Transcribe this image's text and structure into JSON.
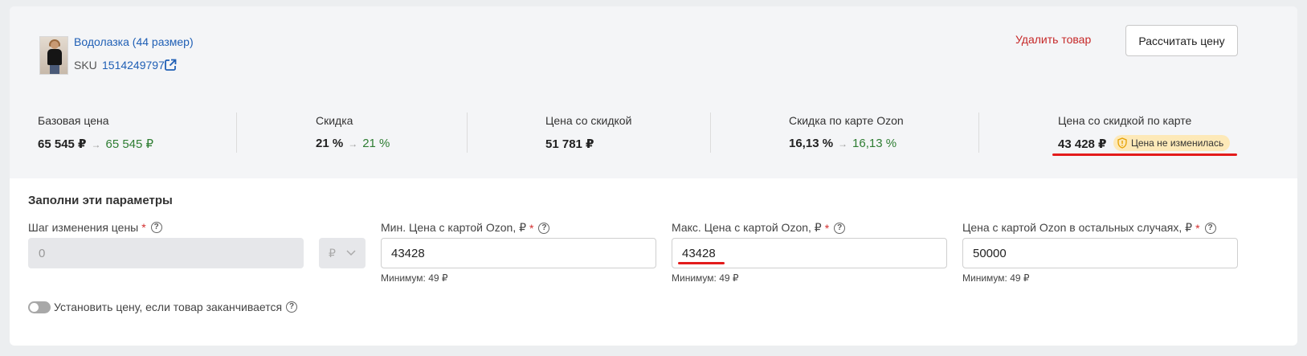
{
  "product": {
    "title": "Водолазка (44 размер)",
    "sku_label": "SKU",
    "sku_value": "1514249797"
  },
  "actions": {
    "delete_label": "Удалить товар",
    "calc_label": "Рассчитать цену"
  },
  "metrics": [
    {
      "label": "Базовая цена",
      "value": "65 545 ₽",
      "new_value": "65 545 ₽"
    },
    {
      "label": "Скидка",
      "value": "21 %",
      "new_value": "21 %"
    },
    {
      "label": "Цена со скидкой",
      "value": "51 781 ₽"
    },
    {
      "label": "Скидка по карте Ozon",
      "value": "16,13 %",
      "new_value": "16,13 %"
    },
    {
      "label": "Цена со скидкой по карте",
      "value": "43 428 ₽",
      "badge": "Цена не изменилась"
    }
  ],
  "form": {
    "title": "Заполни эти параметры",
    "step": {
      "label": "Шаг изменения цены",
      "value": "0",
      "currency": "₽"
    },
    "min_price": {
      "label": "Мин. Цена с картой Ozon, ₽",
      "value": "43428",
      "hint": "Минимум: 49 ₽"
    },
    "max_price": {
      "label": "Макс. Цена с картой Ozon, ₽",
      "value": "43428",
      "hint": "Минимум: 49 ₽"
    },
    "other_price": {
      "label": "Цена с картой Ozon в остальных случаях, ₽",
      "value": "50000",
      "hint": "Минимум: 49 ₽"
    },
    "toggle_label": "Установить цену, если товар заканчивается"
  },
  "colors": {
    "accent_link": "#1f5fb5",
    "delete": "#c62828",
    "positive": "#2e7d32",
    "highlight_line": "#e31b1b",
    "badge_bg": "#fde9b8"
  },
  "icons": [
    "external-link-icon",
    "arrow-right-icon",
    "shield-warning-icon",
    "help-icon",
    "chevron-down-icon"
  ]
}
